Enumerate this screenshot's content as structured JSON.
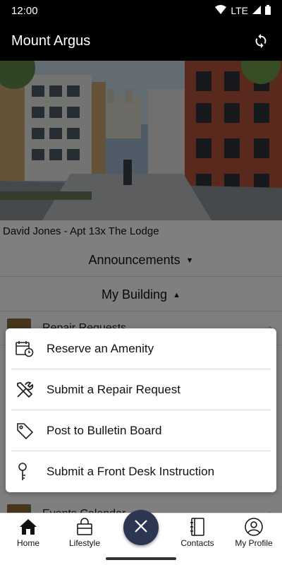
{
  "status": {
    "time": "12:00",
    "network": "LTE"
  },
  "app": {
    "title": "Mount Argus"
  },
  "user": {
    "line": "David Jones - Apt 13x The Lodge"
  },
  "sections": {
    "announcements": "Announcements",
    "my_building": "My Building"
  },
  "under_rows": [
    {
      "label": "Repair Requests"
    },
    {
      "label": "Events Calendar"
    }
  ],
  "menu": [
    {
      "label": "Reserve an Amenity",
      "icon": "calendar-clock-icon"
    },
    {
      "label": "Submit a Repair Request",
      "icon": "tools-icon"
    },
    {
      "label": "Post to Bulletin Board",
      "icon": "tag-icon"
    },
    {
      "label": "Submit a Front Desk Instruction",
      "icon": "key-icon"
    }
  ],
  "nav": [
    {
      "label": "Home",
      "icon": "home-icon"
    },
    {
      "label": "Lifestyle",
      "icon": "shopping-bag-icon"
    },
    {
      "label": "Contacts",
      "icon": "address-book-icon"
    },
    {
      "label": "My Profile",
      "icon": "person-icon"
    }
  ],
  "colors": {
    "fab": "#2c3650",
    "appbar": "#000000"
  }
}
